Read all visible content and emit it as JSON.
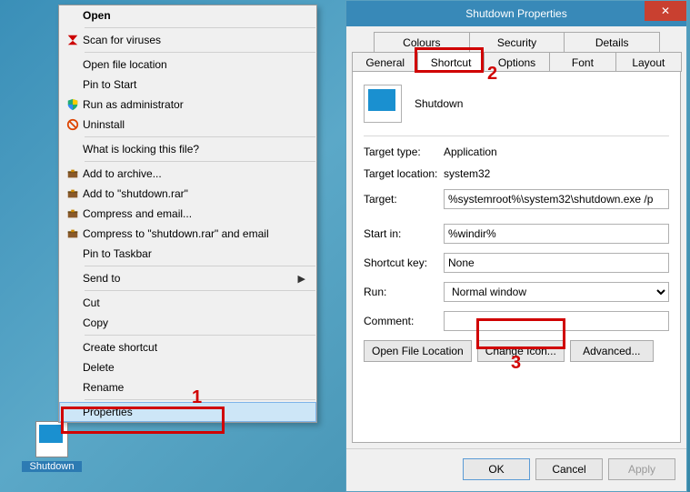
{
  "desktop": {
    "shortcut_label": "Shutdown"
  },
  "context_menu": {
    "open": "Open",
    "scan": "Scan for viruses",
    "open_loc": "Open file location",
    "pin_start": "Pin to Start",
    "run_admin": "Run as administrator",
    "uninstall": "Uninstall",
    "locking": "What is locking this file?",
    "add_archive": "Add to archive...",
    "add_to_rar": "Add to \"shutdown.rar\"",
    "compress_email": "Compress and email...",
    "compress_to_email": "Compress to \"shutdown.rar\" and email",
    "pin_taskbar": "Pin to Taskbar",
    "send_to": "Send to",
    "cut": "Cut",
    "copy": "Copy",
    "create_shortcut": "Create shortcut",
    "delete": "Delete",
    "rename": "Rename",
    "properties": "Properties"
  },
  "dialog": {
    "title": "Shutdown Properties",
    "tabs_row1": [
      "Colours",
      "Security",
      "Details"
    ],
    "tabs_row2": [
      "General",
      "Shortcut",
      "Options",
      "Font",
      "Layout"
    ],
    "active_tab": "Shortcut",
    "name": "Shutdown",
    "fields": {
      "target_type_label": "Target type:",
      "target_type_value": "Application",
      "target_loc_label": "Target location:",
      "target_loc_value": "system32",
      "target_label": "Target:",
      "target_value": "%systemroot%\\system32\\shutdown.exe /p",
      "start_in_label": "Start in:",
      "start_in_value": "%windir%",
      "shortcut_key_label": "Shortcut key:",
      "shortcut_key_value": "None",
      "run_label": "Run:",
      "run_value": "Normal window",
      "comment_label": "Comment:",
      "comment_value": ""
    },
    "buttons": {
      "open_loc": "Open File Location",
      "change_icon": "Change Icon...",
      "advanced": "Advanced..."
    },
    "footer": {
      "ok": "OK",
      "cancel": "Cancel",
      "apply": "Apply"
    }
  },
  "annotations": {
    "n1": "1",
    "n2": "2",
    "n3": "3"
  }
}
